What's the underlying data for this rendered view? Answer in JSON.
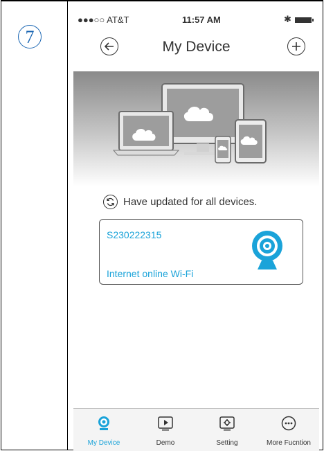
{
  "step_number": "7",
  "status_bar": {
    "carrier": "●●●○○ AT&T",
    "time": "11:57 AM"
  },
  "nav": {
    "title": "My Device"
  },
  "banner": {
    "illustration": "devices-cloud-illustration"
  },
  "update_message": "Have updated for all devices.",
  "devices": [
    {
      "id": "S230222315",
      "status": "Internet online Wi-Fi",
      "icon": "webcam-icon"
    }
  ],
  "tabs": [
    {
      "label": "My Device",
      "icon": "webcam-icon",
      "active": true
    },
    {
      "label": "Demo",
      "icon": "play-icon",
      "active": false
    },
    {
      "label": "Setting",
      "icon": "gear-icon",
      "active": false
    },
    {
      "label": "More Fucntion",
      "icon": "more-icon",
      "active": false
    }
  ],
  "colors": {
    "accent": "#1aa3d9",
    "step_badge": "#1a66b3",
    "text": "#333333"
  }
}
